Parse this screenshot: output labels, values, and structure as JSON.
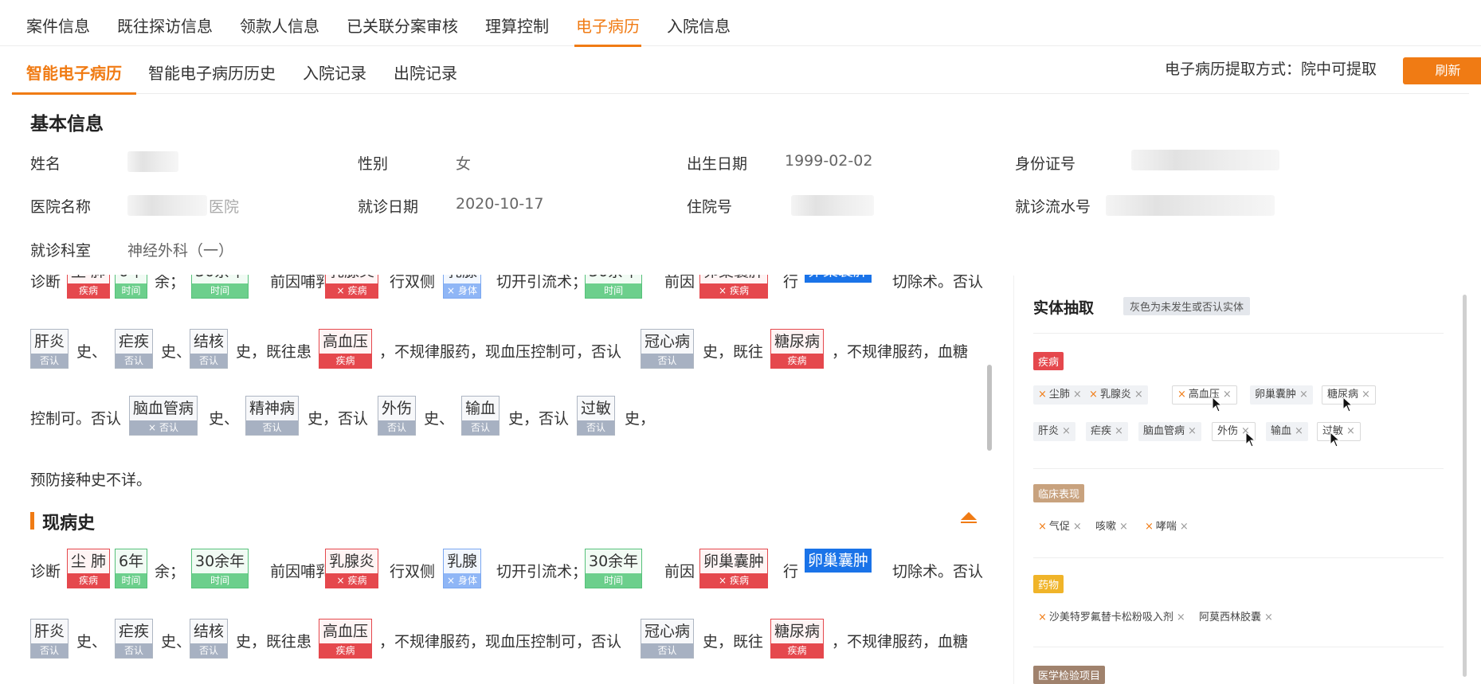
{
  "tabs_top": [
    {
      "label": "案件信息"
    },
    {
      "label": "既往探访信息"
    },
    {
      "label": "领款人信息"
    },
    {
      "label": "已关联分案审核"
    },
    {
      "label": "理算控制"
    },
    {
      "label": "电子病历",
      "active": true
    },
    {
      "label": "入院信息"
    }
  ],
  "tabs_sub": [
    {
      "label": "智能电子病历",
      "active": true
    },
    {
      "label": "智能电子病历历史"
    },
    {
      "label": "入院记录"
    },
    {
      "label": "出院记录"
    }
  ],
  "extract": {
    "label": "电子病历提取方式：院中可提取",
    "refresh": "刷新"
  },
  "basic": {
    "title": "基本信息",
    "name_label": "姓名",
    "gender_label": "性别",
    "gender": "女",
    "birth_label": "出生日期",
    "birth": "1999-02-02",
    "id_label": "身份证号",
    "hospital_label": "医院名称",
    "hospital_suffix": "医院",
    "visit_date_label": "就诊日期",
    "visit_date": "2020-10-17",
    "inpatient_label": "住院号",
    "serial_label": "就诊流水号",
    "dept_label": "就诊科室",
    "dept": "神经外科（一）"
  },
  "record": {
    "labels": {
      "disease": "疾病",
      "time": "时间",
      "body": "身体",
      "denied": "否认",
      "x": "×"
    },
    "row1": {
      "t0": "诊断",
      "e_dust": "尘 肺",
      "e_6y": "6年",
      "t1": "余；",
      "e_30y": "30余年",
      "t2": "前因哺乳",
      "e_mastitis": "乳腺炎",
      "t3": "行双侧",
      "e_breast": "乳腺",
      "t4": "切开引流术；",
      "t5": "前因",
      "e_ovary": "卵巢囊肿",
      "t6": "行",
      "e_ovary_surg": "卵巢囊肿",
      "t7": "切除术。否认"
    },
    "row2": {
      "e_hep": "肝炎",
      "t1": "史、",
      "e_mal": "疟疾",
      "t2": "史、",
      "e_tb": "结核",
      "t3": "史，既往患",
      "e_htn": "高血压",
      "t4": "，不规律服药，现血压控制可，否认",
      "e_chd": "冠心病",
      "t5": "史，既往",
      "e_dm": "糖尿病",
      "t6": "，不规律服药，血糖"
    },
    "row3": {
      "t0": "控制可。否认",
      "e_cvd": "脑血管病",
      "t1": "史、",
      "e_psy": "精神病",
      "t2": "史，否认",
      "e_trauma": "外伤",
      "t3": "史、",
      "e_trans": "输血",
      "t4": "史，否认",
      "e_allergy": "过敏",
      "t5": "史，"
    },
    "vaccine": "预防接种史不详。",
    "present_title": "现病史"
  },
  "entity": {
    "title": "实体抽取",
    "hint": "灰色为未发生或否认实体",
    "cat_disease": "疾病",
    "disease_chips": [
      "尘肺",
      "乳腺炎",
      "高血压",
      "卵巢囊肿",
      "糖尿病",
      "肝炎",
      "疟疾",
      "脑血管病",
      "外伤",
      "输血",
      "过敏"
    ],
    "cat_clinical": "临床表现",
    "clinical_chips": [
      "气促",
      "咳嗽",
      "哮喘"
    ],
    "cat_drug": "药物",
    "drug_chips": [
      "沙美特罗氟替卡松粉吸入剂",
      "阿莫西林胶囊"
    ],
    "cat_lab": "医学检验项目",
    "close": "×",
    "x": "×"
  },
  "colors": {
    "accent": "#f07b14",
    "disease": "#e5484d",
    "time": "#6ccf8c",
    "body": "#8fb6f6",
    "denied": "#a7b1c2",
    "surgery": "#1a73e8"
  }
}
